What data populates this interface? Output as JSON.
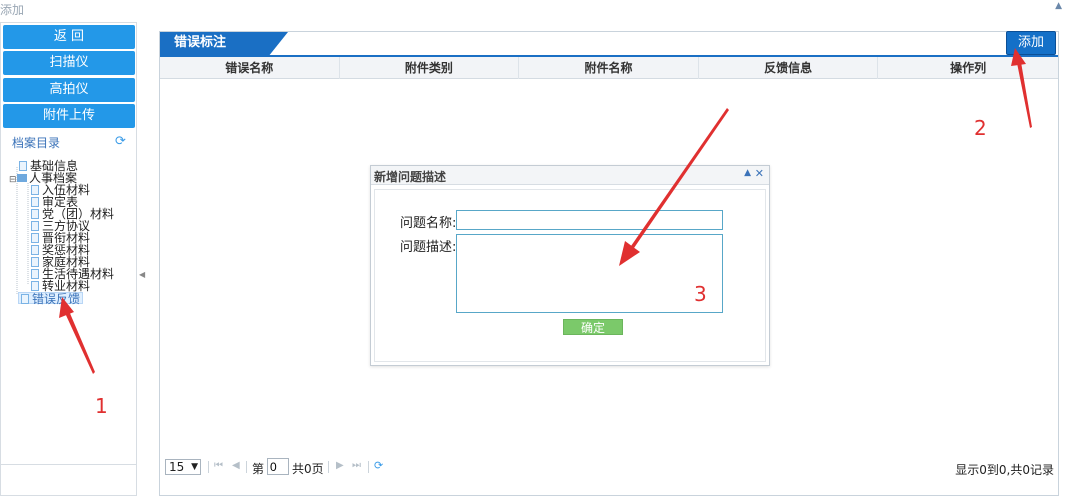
{
  "window": {
    "title": "添加"
  },
  "left_panel": {
    "buttons": [
      "返 回",
      "扫描仪",
      "高拍仪",
      "附件上传"
    ],
    "tree_title": "档案目录",
    "tree": {
      "basic": "基础信息",
      "personnel": "人事档案",
      "children": [
        "入伍材料",
        "审定表",
        "党（团）材料",
        "三方协议",
        "晋衔材料",
        "奖惩材料",
        "家庭材料",
        "生活待遇材料",
        "转业材料"
      ],
      "error_feedback": "错误反馈"
    }
  },
  "main_panel": {
    "title": "错误标注",
    "add_label": "添加",
    "columns": [
      "错误名称",
      "附件类别",
      "附件名称",
      "反馈信息",
      "操作列"
    ]
  },
  "dialog": {
    "title": "新增问题描述",
    "name_label": "问题名称:",
    "desc_label": "问题描述:",
    "name_value": "",
    "desc_value": "",
    "confirm_label": "确定"
  },
  "pager": {
    "page_size": "15",
    "page_prefix": "第",
    "page_value": "0",
    "total_pages": "共0页",
    "info": "显示0到0,共0记录"
  },
  "annotations": {
    "labels": [
      "1",
      "2",
      "3"
    ],
    "color": "#e03030"
  },
  "colors": {
    "accent_button": "#2398e8",
    "header_blue": "#1a6fc4",
    "confirm_green": "#7bc96a"
  }
}
